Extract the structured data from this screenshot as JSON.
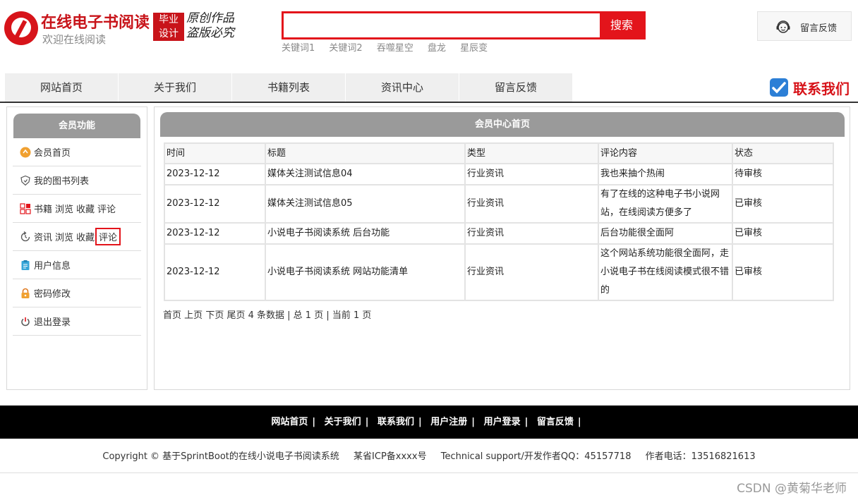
{
  "header": {
    "logo_title": "在线电子书阅读",
    "logo_subtitle": "欢迎在线阅读",
    "badge_line1": "毕业",
    "badge_line2": "设计",
    "slogan_line1": "原创作品",
    "slogan_line2": "盗版必究",
    "search_button": "搜索",
    "search_value": "",
    "keywords": [
      "关键词1",
      "关键词2",
      "吞噬星空",
      "盘龙",
      "星辰变"
    ],
    "feedback_label": "留言反馈"
  },
  "nav": {
    "items": [
      "网站首页",
      "关于我们",
      "书籍列表",
      "资讯中心",
      "留言反馈"
    ],
    "contact_label": "联系我们"
  },
  "sidebar": {
    "title": "会员功能",
    "items": [
      {
        "label": "会员首页",
        "icon": "home-icon"
      },
      {
        "label": "我的图书列表",
        "icon": "shield-icon"
      },
      {
        "label": "书籍",
        "subs": [
          "浏览",
          "收藏",
          "评论"
        ],
        "icon": "grid-icon"
      },
      {
        "label": "资讯",
        "subs": [
          "浏览",
          "收藏",
          "评论"
        ],
        "icon": "refresh-icon"
      },
      {
        "label": "用户信息",
        "icon": "clipboard-icon"
      },
      {
        "label": "密码修改",
        "icon": "lock-icon"
      },
      {
        "label": "退出登录",
        "icon": "power-icon"
      }
    ]
  },
  "main": {
    "title": "会员中心首页",
    "columns": [
      "时间",
      "标题",
      "类型",
      "评论内容",
      "状态"
    ],
    "rows": [
      [
        "2023-12-12",
        "媒体关注测试信息04",
        "行业资讯",
        "我也来抽个热闹",
        "待审核"
      ],
      [
        "2023-12-12",
        "媒体关注测试信息05",
        "行业资讯",
        "有了在线的这种电子书小说网站，在线阅读方便多了",
        "已审核"
      ],
      [
        "2023-12-12",
        "小说电子书阅读系统 后台功能",
        "行业资讯",
        "后台功能很全面阿",
        "已审核"
      ],
      [
        "2023-12-12",
        "小说电子书阅读系统 网站功能清单",
        "行业资讯",
        "这个网站系统功能很全面阿，走小说电子书在线阅读模式很不错的",
        "已审核"
      ]
    ],
    "pager": {
      "first": "首页",
      "prev": "上页",
      "next": "下页",
      "last": "尾页",
      "info": "4 条数据 | 总 1 页 | 当前 1 页"
    }
  },
  "footer": {
    "links": [
      "网站首页",
      "关于我们",
      "联系我们",
      "用户注册",
      "用户登录",
      "留言反馈"
    ],
    "copyright": "Copyright © 基于SprintBoot的在线小说电子书阅读系统",
    "icp": "某省ICP备xxxx号",
    "support": "Technical support/开发作者QQ：45157718",
    "phone": "作者电话：13516821613"
  },
  "watermark": "CSDN @黄菊华老师",
  "colors": {
    "brand_red": "#e3141b",
    "panel_gray": "#9a9a9a",
    "footer_black": "#000000"
  }
}
